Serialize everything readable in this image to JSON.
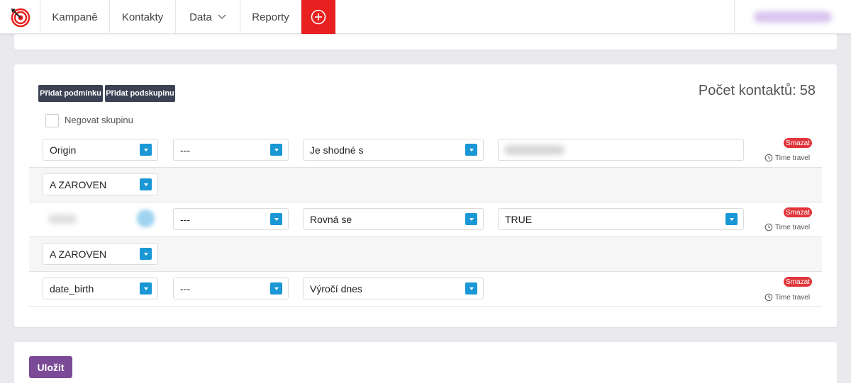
{
  "nav": {
    "items": [
      {
        "label": "Kampaně"
      },
      {
        "label": "Kontakty"
      },
      {
        "label": "Data"
      },
      {
        "label": "Reporty"
      }
    ],
    "add_icon": "plus-circle-icon",
    "logo_icon": "target-logo-icon",
    "accent": "#e8201f"
  },
  "toolbar": {
    "add_condition": "Přidat podmínku",
    "add_subgroup": "Přidat podskupinu",
    "count_label": "Počet kontaktů:",
    "count_value": "58"
  },
  "negate": {
    "label": "Negovat skupinu",
    "checked": false
  },
  "conditions": [
    {
      "field": "Origin",
      "modifier": "---",
      "operator": "Je shodné s",
      "delete_label": "Smazat",
      "time_travel_label": "Time travel"
    },
    {
      "field": "",
      "modifier": "---",
      "operator": "Rovná se",
      "value": "TRUE",
      "delete_label": "Smazat",
      "time_travel_label": "Time travel"
    },
    {
      "field": "date_birth",
      "modifier": "---",
      "operator": "Výročí dnes",
      "delete_label": "Smazat",
      "time_travel_label": "Time travel"
    }
  ],
  "connectors": [
    "A ZAROVEN",
    "A ZAROVEN"
  ],
  "save": {
    "label": "Uložit",
    "color": "#7b4a96"
  },
  "colors": {
    "select_arrow": "#1a97d5",
    "delete_badge": "#e0353b",
    "dark_button": "#3c4254"
  }
}
